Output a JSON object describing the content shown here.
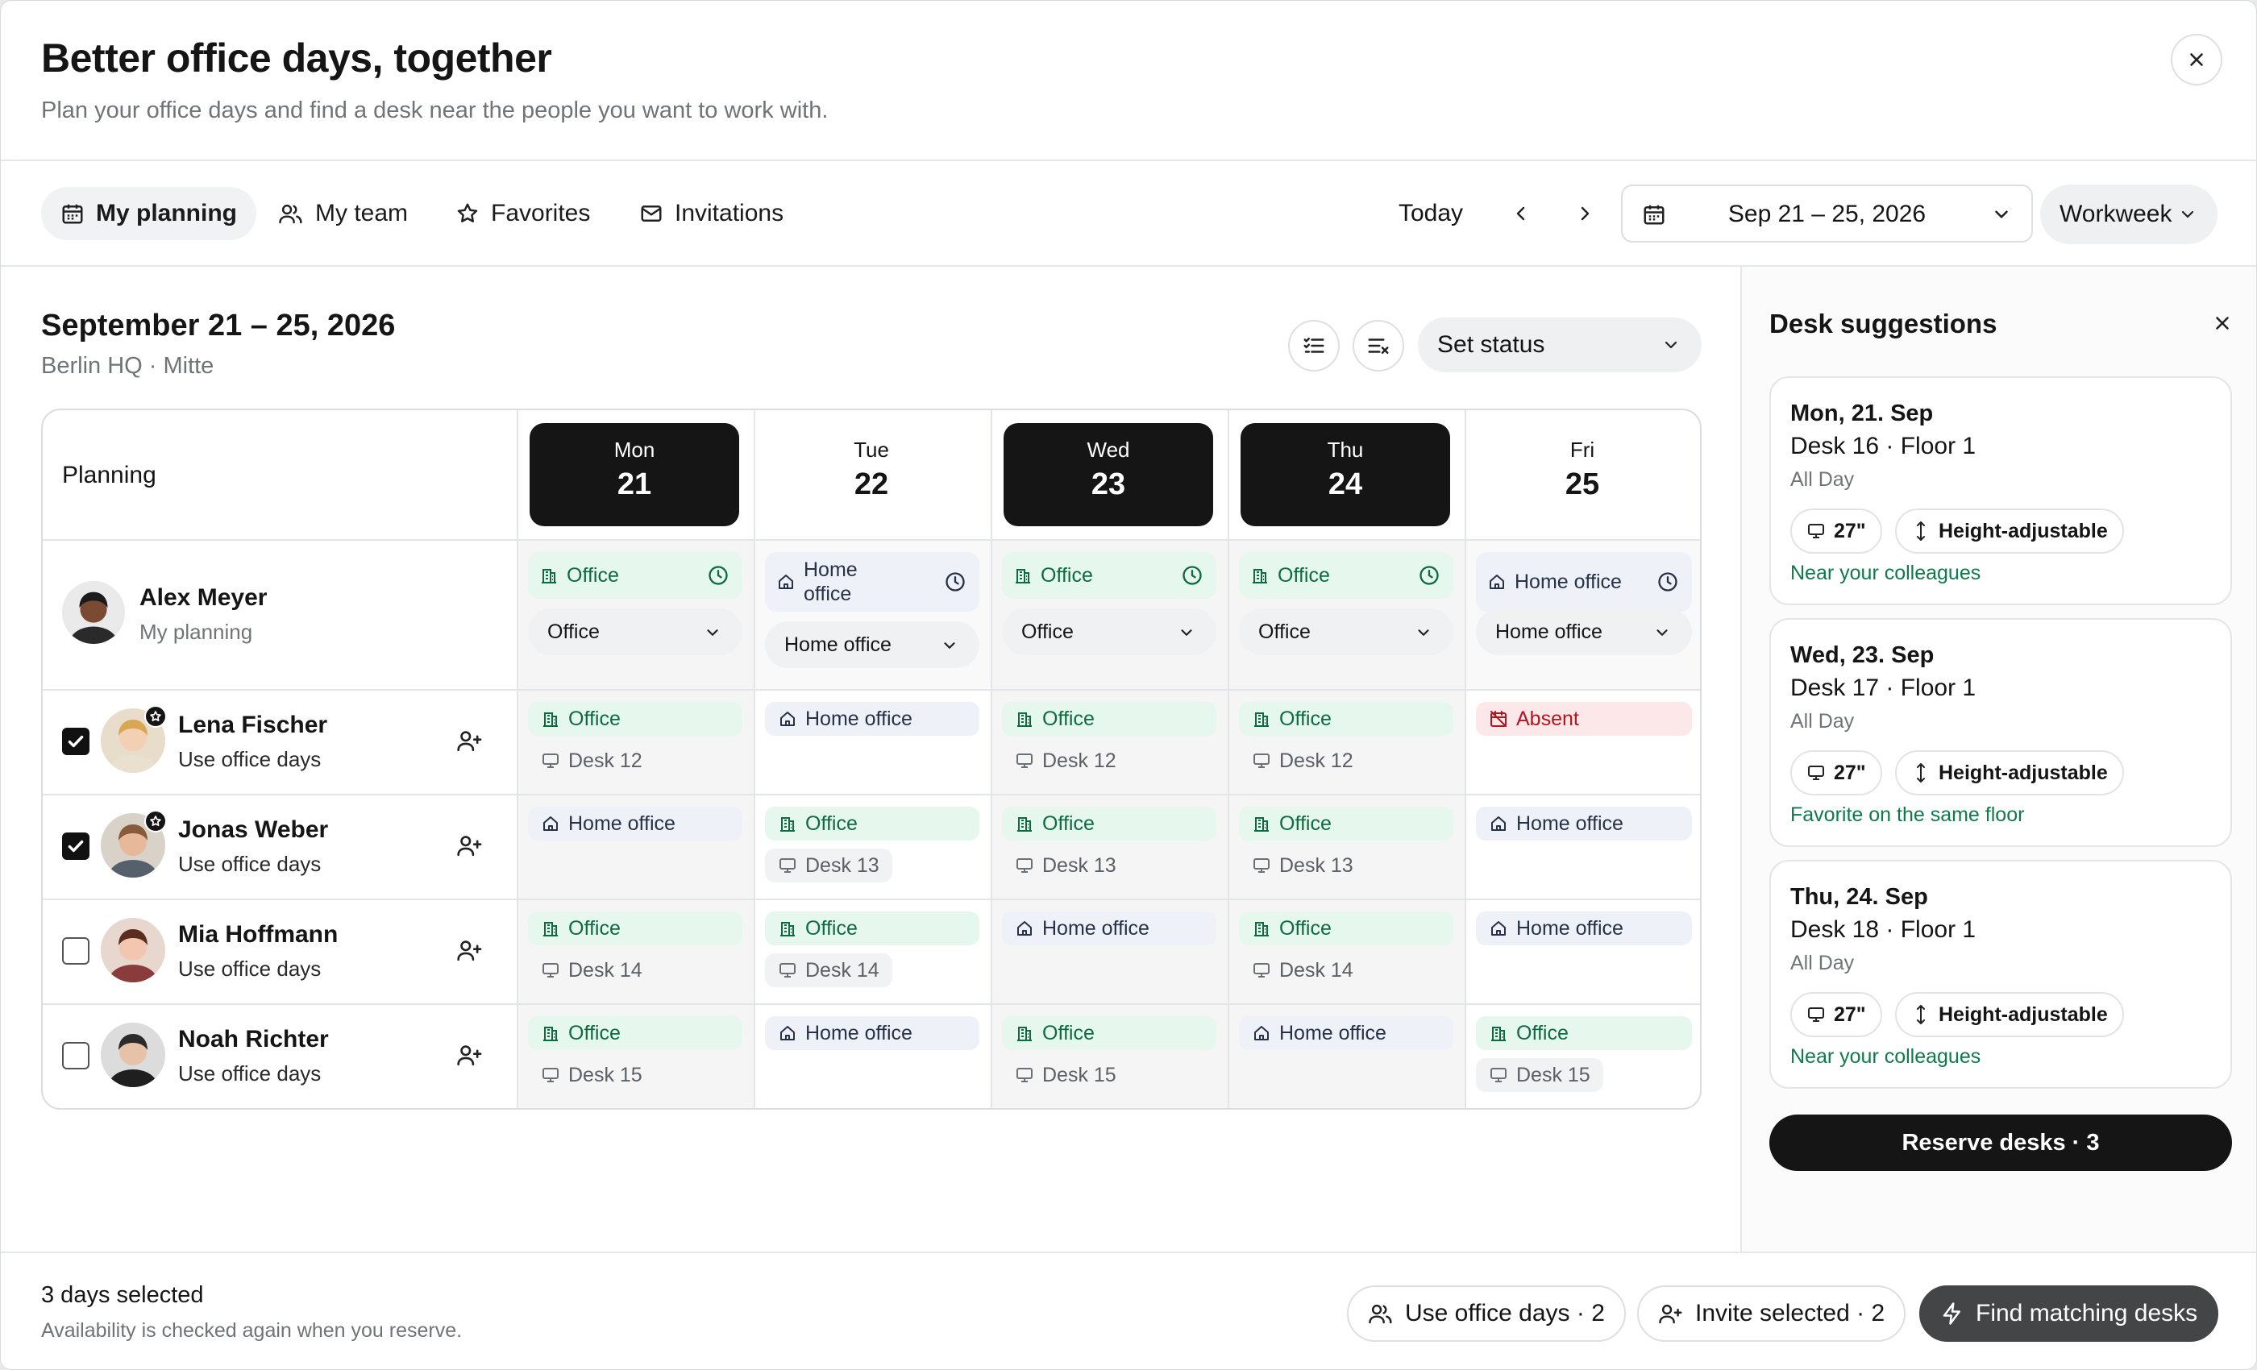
{
  "header": {
    "title": "Better office days, together",
    "subtitle": "Plan your office days and find a desk near the people you want to work with."
  },
  "tabs": [
    {
      "label": "My planning",
      "icon": "calendar-icon"
    },
    {
      "label": "My team",
      "icon": "team-icon"
    },
    {
      "label": "Favorites",
      "icon": "star-icon"
    },
    {
      "label": "Invitations",
      "icon": "mail-icon"
    }
  ],
  "nav": {
    "today": "Today",
    "date_range": "Sep 21 – 25, 2026",
    "view": "Workweek"
  },
  "main": {
    "title": "September 21 – 25, 2026",
    "location": "Berlin HQ · Mitte",
    "set_status": "Set status"
  },
  "grid": {
    "planning_label": "Planning",
    "days": [
      {
        "name": "Mon",
        "date": "21",
        "selected": true
      },
      {
        "name": "Tue",
        "date": "22",
        "selected": false
      },
      {
        "name": "Wed",
        "date": "23",
        "selected": true
      },
      {
        "name": "Thu",
        "date": "24",
        "selected": true
      },
      {
        "name": "Fri",
        "date": "25",
        "selected": false
      }
    ],
    "me": {
      "name": "Alex Meyer",
      "sub": "My planning",
      "days": [
        {
          "status": "Office",
          "select": "Office"
        },
        {
          "status": "Home office",
          "select": "Home office"
        },
        {
          "status": "Office",
          "select": "Office"
        },
        {
          "status": "Office",
          "select": "Office"
        },
        {
          "status": "Home office",
          "select": "Home office"
        }
      ]
    },
    "people": [
      {
        "name": "Lena Fischer",
        "sub": "Use office days",
        "checked": true,
        "starred": true,
        "days": [
          {
            "status": "Office",
            "desk": "Desk 12"
          },
          {
            "status": "Home office"
          },
          {
            "status": "Office",
            "desk": "Desk 12"
          },
          {
            "status": "Office",
            "desk": "Desk 12"
          },
          {
            "status": "Absent"
          }
        ]
      },
      {
        "name": "Jonas Weber",
        "sub": "Use office days",
        "checked": true,
        "starred": true,
        "days": [
          {
            "status": "Home office"
          },
          {
            "status": "Office",
            "desk": "Desk 13"
          },
          {
            "status": "Office",
            "desk": "Desk 13"
          },
          {
            "status": "Office",
            "desk": "Desk 13"
          },
          {
            "status": "Home office"
          }
        ]
      },
      {
        "name": "Mia Hoffmann",
        "sub": "Use office days",
        "checked": false,
        "starred": false,
        "days": [
          {
            "status": "Office",
            "desk": "Desk 14"
          },
          {
            "status": "Office",
            "desk": "Desk 14"
          },
          {
            "status": "Home office"
          },
          {
            "status": "Office",
            "desk": "Desk 14"
          },
          {
            "status": "Home office"
          }
        ]
      },
      {
        "name": "Noah Richter",
        "sub": "Use office days",
        "checked": false,
        "starred": false,
        "days": [
          {
            "status": "Office",
            "desk": "Desk 15"
          },
          {
            "status": "Home office"
          },
          {
            "status": "Office",
            "desk": "Desk 15"
          },
          {
            "status": "Home office"
          },
          {
            "status": "Office",
            "desk": "Desk 15"
          }
        ]
      }
    ]
  },
  "side": {
    "title": "Desk suggestions",
    "cards": [
      {
        "date": "Mon, 21. Sep",
        "desk": "Desk 16 · Floor 1",
        "time": "All Day",
        "monitor": "27\"",
        "feature": "Height-adjustable",
        "reason": "Near your colleagues"
      },
      {
        "date": "Wed, 23. Sep",
        "desk": "Desk 17 · Floor 1",
        "time": "All Day",
        "monitor": "27\"",
        "feature": "Height-adjustable",
        "reason": "Favorite on the same floor"
      },
      {
        "date": "Thu, 24. Sep",
        "desk": "Desk 18 · Floor 1",
        "time": "All Day",
        "monitor": "27\"",
        "feature": "Height-adjustable",
        "reason": "Near your colleagues"
      }
    ],
    "reserve": "Reserve desks · 3"
  },
  "footer": {
    "selected": "3 days selected",
    "note": "Availability is checked again when you reserve.",
    "use_office": "Use office days · 2",
    "invite": "Invite selected · 2",
    "find": "Find matching desks"
  },
  "colors": {
    "accent_dark": "#151515",
    "office_bg": "#e6f7ee",
    "office_text": "#0d6b40",
    "home_bg": "#eef2f8",
    "absent_bg": "#fde8e9",
    "absent_text": "#b3141d",
    "reason_green": "#0f7a4a"
  }
}
